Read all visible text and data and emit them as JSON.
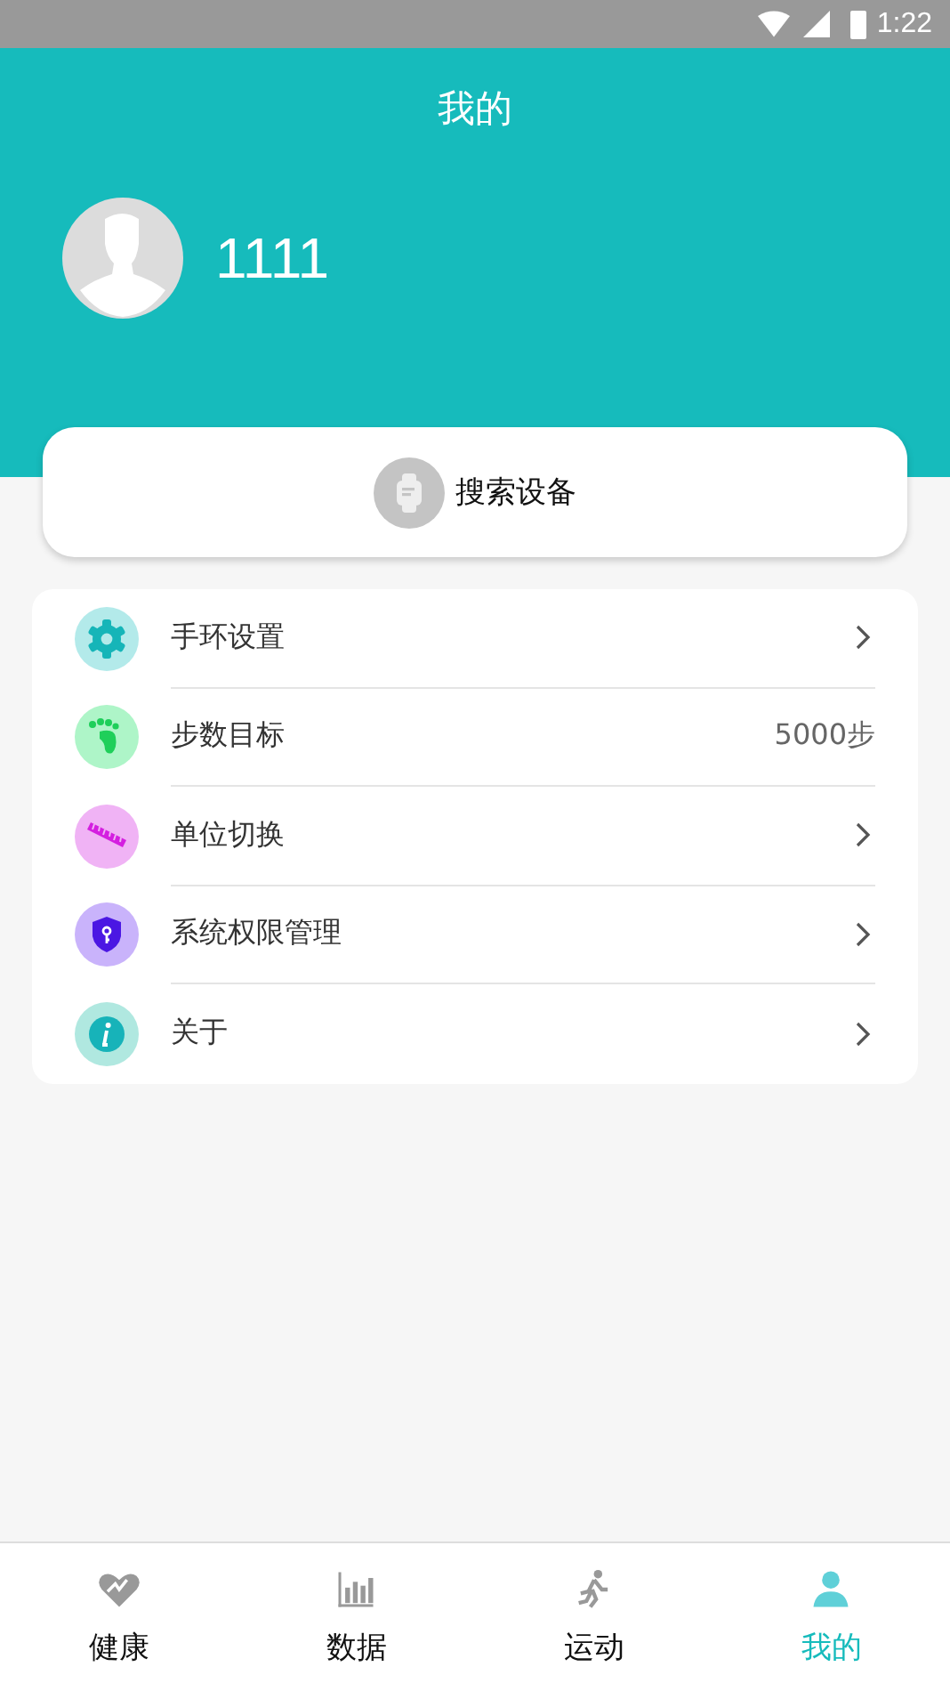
{
  "status_bar": {
    "time": "1:22"
  },
  "header": {
    "title": "我的"
  },
  "profile": {
    "name": "1111"
  },
  "search_button": {
    "label": "搜索设备"
  },
  "menu": [
    {
      "kind": "gear",
      "label": "手环设置",
      "color": "#b3eaea"
    },
    {
      "kind": "foot",
      "label": "步数目标",
      "value": "5000步",
      "color": "#aef5c8"
    },
    {
      "kind": "ruler",
      "label": "单位切换",
      "color": "#f0b3f5"
    },
    {
      "kind": "shield",
      "label": "系统权限管理",
      "color": "#c9b3fb"
    },
    {
      "kind": "info",
      "label": "关于",
      "color": "#b0e8e0"
    }
  ],
  "tabs": [
    {
      "kind": "heart",
      "label": "健康",
      "selected": false
    },
    {
      "kind": "bars",
      "label": "数据",
      "selected": false
    },
    {
      "kind": "run",
      "label": "运动",
      "selected": false
    },
    {
      "kind": "person",
      "label": "我的",
      "selected": true
    }
  ]
}
